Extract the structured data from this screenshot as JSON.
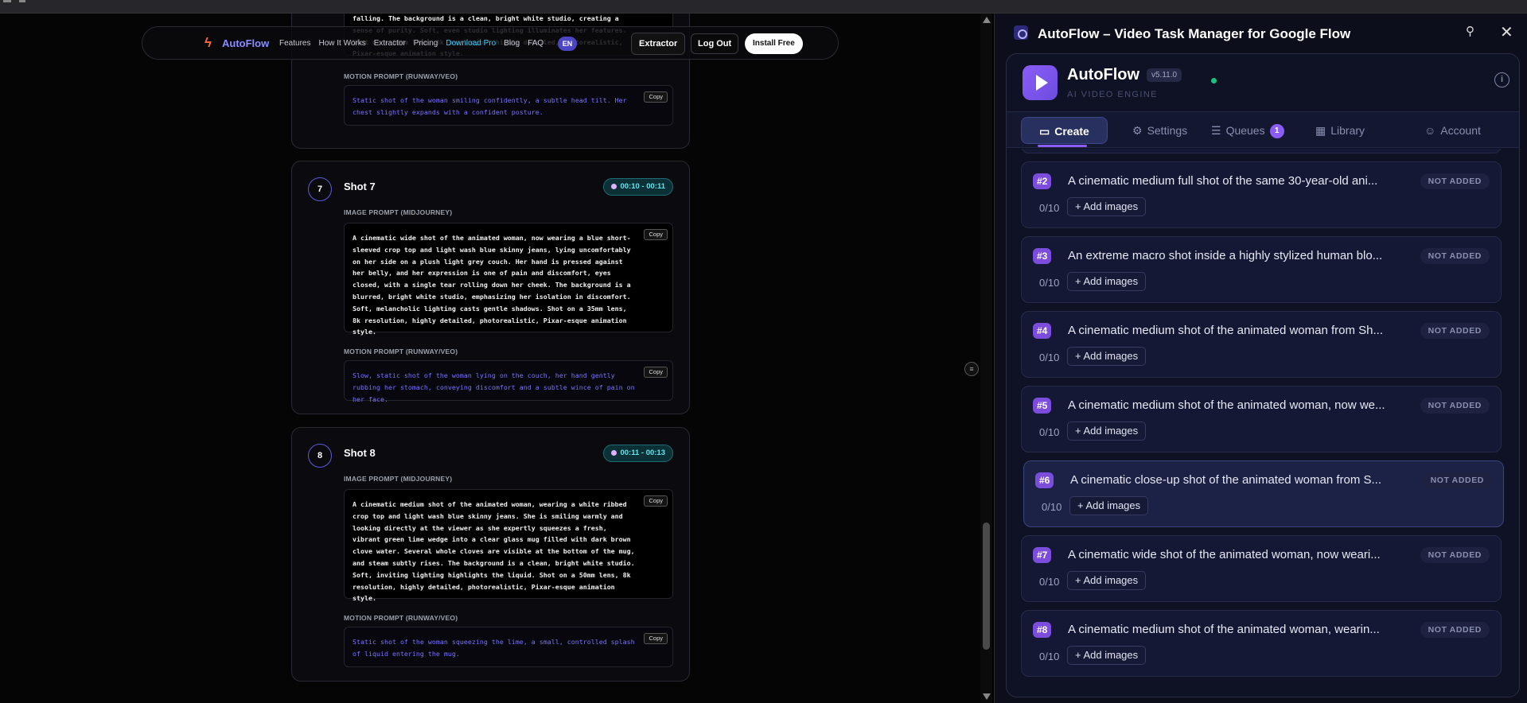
{
  "browser": {
    "strip": ""
  },
  "site": {
    "brand": "AutoFlow",
    "nav_links": [
      "Features",
      "How It Works",
      "Extractor",
      "Pricing",
      "Download Pro",
      "Blog",
      "FAQ"
    ],
    "lang": "EN",
    "extractor_btn": "Extractor",
    "logout_btn": "Log Out",
    "install_btn": "Install Free"
  },
  "shot6": {
    "image_prompt_tail": "falling. The background is a clean, bright white studio, creating a sense of purity. Soft, even studio lighting illuminates her features. Shot on a 50mm lens, 8k resolution, highly detailed, photorealistic, Pixar-esque animation style.",
    "motion_label": "MOTION PROMPT (RUNWAY/VEO)",
    "motion_prompt": "Static shot of the woman smiling confidently, a subtle head tilt. Her chest slightly expands with a confident posture.",
    "copy": "Copy"
  },
  "shots": [
    {
      "num": "7",
      "title": "Shot 7",
      "time": "00:10 - 00:11",
      "image_label": "IMAGE PROMPT (MIDJOURNEY)",
      "image_prompt": "A cinematic wide shot of the animated woman, now wearing a blue short-sleeved crop top and light wash blue skinny jeans, lying uncomfortably on her side on a plush light grey couch. Her hand is pressed against her belly, and her expression is one of pain and discomfort, eyes closed, with a single tear rolling down her cheek. The background is a blurred, bright white studio, emphasizing her isolation in discomfort. Soft, melancholic lighting casts gentle shadows. Shot on a 35mm lens, 8k resolution, highly detailed, photorealistic, Pixar-esque animation style.",
      "motion_label": "MOTION PROMPT (RUNWAY/VEO)",
      "motion_prompt": "Slow, static shot of the woman lying on the couch, her hand gently rubbing her stomach, conveying discomfort and a subtle wince of pain on her face.",
      "copy": "Copy"
    },
    {
      "num": "8",
      "title": "Shot 8",
      "time": "00:11 - 00:13",
      "image_label": "IMAGE PROMPT (MIDJOURNEY)",
      "image_prompt": "A cinematic medium shot of the animated woman, wearing a white ribbed crop top and light wash blue skinny jeans. She is smiling warmly and looking directly at the viewer as she expertly squeezes a fresh, vibrant green lime wedge into a clear glass mug filled with dark brown clove water. Several whole cloves are visible at the bottom of the mug, and steam subtly rises. The background is a clean, bright white studio. Soft, inviting lighting highlights the liquid. Shot on a 50mm lens, 8k resolution, highly detailed, photorealistic, Pixar-esque animation style.",
      "motion_label": "MOTION PROMPT (RUNWAY/VEO)",
      "motion_prompt": "Static shot of the woman squeezing the lime, a small, controlled splash of liquid entering the mug.",
      "copy": "Copy"
    }
  ],
  "panel": {
    "title": "AutoFlow – Video Task Manager for Google Flow",
    "brand": "AutoFlow",
    "version": "v5.11.0",
    "tagline": "AI VIDEO ENGINE",
    "tabs": [
      {
        "label": "Create",
        "icon": "video-icon"
      },
      {
        "label": "Settings",
        "icon": "gear-icon"
      },
      {
        "label": "Queues",
        "icon": "list-icon",
        "badge": "1"
      },
      {
        "label": "Library",
        "icon": "grid-icon"
      },
      {
        "label": "Account",
        "icon": "user-icon"
      }
    ],
    "items": [
      {
        "num": "#2",
        "desc": "A cinematic medium full shot of the same 30-year-old ani...",
        "status": "NOT ADDED",
        "count": "0/10",
        "add": "+ Add images"
      },
      {
        "num": "#3",
        "desc": "An extreme macro shot inside a highly stylized human blo...",
        "status": "NOT ADDED",
        "count": "0/10",
        "add": "+ Add images"
      },
      {
        "num": "#4",
        "desc": "A cinematic medium shot of the animated woman from Sh...",
        "status": "NOT ADDED",
        "count": "0/10",
        "add": "+ Add images"
      },
      {
        "num": "#5",
        "desc": "A cinematic medium shot of the animated woman, now we...",
        "status": "NOT ADDED",
        "count": "0/10",
        "add": "+ Add images"
      },
      {
        "num": "#6",
        "desc": "A cinematic close-up shot of the animated woman from S...",
        "status": "NOT ADDED",
        "count": "0/10",
        "add": "+ Add images"
      },
      {
        "num": "#7",
        "desc": "A cinematic wide shot of the animated woman, now weari...",
        "status": "NOT ADDED",
        "count": "0/10",
        "add": "+ Add images"
      },
      {
        "num": "#8",
        "desc": "A cinematic medium shot of the animated woman, wearin...",
        "status": "NOT ADDED",
        "count": "0/10",
        "add": "+ Add images"
      }
    ]
  },
  "colors": {
    "accent": "#8b5cf6",
    "cyan": "#5fe6f0",
    "motion_text": "#7b72ff"
  }
}
